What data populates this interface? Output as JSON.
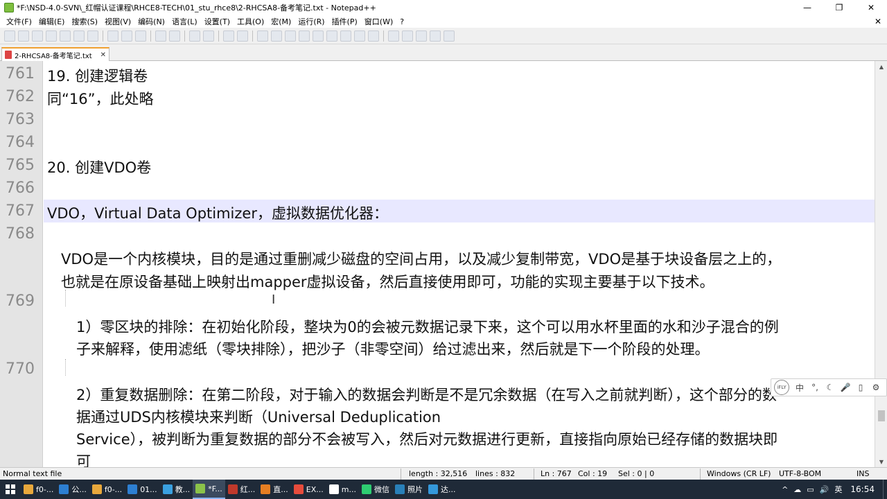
{
  "window": {
    "title": "*F:\\NSD-4.0-SVN\\_红帽认证课程\\RHCE8-TECH\\01_stu_rhce8\\2-RHCSA8-备考笔记.txt - Notepad++",
    "minimize": "—",
    "restore": "❐",
    "close": "✕"
  },
  "menu": {
    "items": [
      "文件(F)",
      "编辑(E)",
      "搜索(S)",
      "视图(V)",
      "编码(N)",
      "语言(L)",
      "设置(T)",
      "工具(O)",
      "宏(M)",
      "运行(R)",
      "插件(P)",
      "窗口(W)",
      "?"
    ],
    "close_doc": "✕"
  },
  "toolbar": {
    "group1": [
      "new-file-icon",
      "open-file-icon",
      "save-icon",
      "save-all-icon",
      "close-icon",
      "close-all-icon",
      "print-icon"
    ],
    "group2": [
      "cut-icon",
      "copy-icon",
      "paste-icon"
    ],
    "group3": [
      "undo-icon",
      "redo-icon"
    ],
    "group4": [
      "find-icon",
      "replace-icon"
    ],
    "group5": [
      "zoom-in-icon",
      "zoom-out-icon"
    ],
    "group6": [
      "sync-v-icon",
      "sync-h-icon",
      "word-wrap-icon",
      "all-chars-icon",
      "indent-guide-icon",
      "udl-icon",
      "doc-map-icon",
      "function-list-icon",
      "folder-workspace-icon"
    ],
    "group7": [
      "record-macro-icon",
      "stop-macro-icon",
      "play-macro-icon",
      "run-macro-icon",
      "save-macro-icon"
    ]
  },
  "tab": {
    "label": "2-RHCSA8-备考笔记.txt",
    "close": "✕"
  },
  "editor": {
    "lines": [
      {
        "no": "761",
        "text": "19. 创建逻辑卷"
      },
      {
        "no": "762",
        "text": "同“16”，此处略"
      },
      {
        "no": "763",
        "text": ""
      },
      {
        "no": "764",
        "text": ""
      },
      {
        "no": "765",
        "text": "20. 创建VDO卷"
      },
      {
        "no": "766",
        "text": ""
      },
      {
        "no": "767",
        "text": "VDO，Virtual Data Optimizer，虚拟数据优化器："
      },
      {
        "no": "768",
        "text": "VDO是一个内核模块，目的是通过重删减少磁盘的空间占用，以及减少复制带宽，VDO是基于块设备层之上的，",
        "cont": [
          "也就是在原设备基础上映射出mapper虚拟设备，然后直接使用即可，功能的实现主要基于以下技术。"
        ]
      },
      {
        "no": "769",
        "text": "1）零区块的排除：在初始化阶段，整块为0的会被元数据记录下来，这个可以用水杯里面的水和沙子混合的例",
        "cont": [
          "子来解释，使用滤纸（零块排除），把沙子（非零空间）给过滤出来，然后就是下一个阶段的处理。"
        ]
      },
      {
        "no": "770",
        "text": "2）重复数据删除：在第二阶段，对于输入的数据会判断是不是冗余数据（在写入之前就判断），这个部分的数",
        "cont": [
          "据通过UDS内核模块来判断（Universal Deduplication",
          "Service），被判断为重复数据的部分不会被写入，然后对元数据进行更新，直接指向原始已经存储的数据块即",
          "可"
        ]
      }
    ]
  },
  "ime": {
    "logo": "iFLY",
    "buttons": [
      "中",
      "°,",
      "☾",
      "🎤",
      "▯",
      "⚙"
    ]
  },
  "status": {
    "file_type": "Normal text file",
    "length": "length : 32,516",
    "lines": "lines : 832",
    "ln": "Ln : 767",
    "col": "Col : 19",
    "sel": "Sel : 0 | 0",
    "eol": "Windows (CR LF)",
    "encoding": "UTF-8-BOM",
    "mode": "INS"
  },
  "taskbar": {
    "items": [
      {
        "label": "f0-...",
        "color": "#e8a83c"
      },
      {
        "label": "公...",
        "color": "#2d7fd2"
      },
      {
        "label": "f0-...",
        "color": "#e8a83c"
      },
      {
        "label": "01...",
        "color": "#2d7fd2"
      },
      {
        "label": "教...",
        "color": "#3aa0e0"
      },
      {
        "label": "*F...",
        "color": "#8bc34a",
        "active": true
      },
      {
        "label": "红...",
        "color": "#c0392b"
      },
      {
        "label": "直...",
        "color": "#e67e22"
      },
      {
        "label": "EX...",
        "color": "#e74c3c"
      },
      {
        "label": "m...",
        "color": "#ffffff"
      },
      {
        "label": "微信",
        "color": "#2ecc71"
      },
      {
        "label": "照片",
        "color": "#2980b9"
      },
      {
        "label": "达...",
        "color": "#3498db"
      }
    ],
    "tray_icons": [
      "^",
      "☁",
      "▭",
      "🔊",
      "英"
    ],
    "clock": "16:54"
  }
}
